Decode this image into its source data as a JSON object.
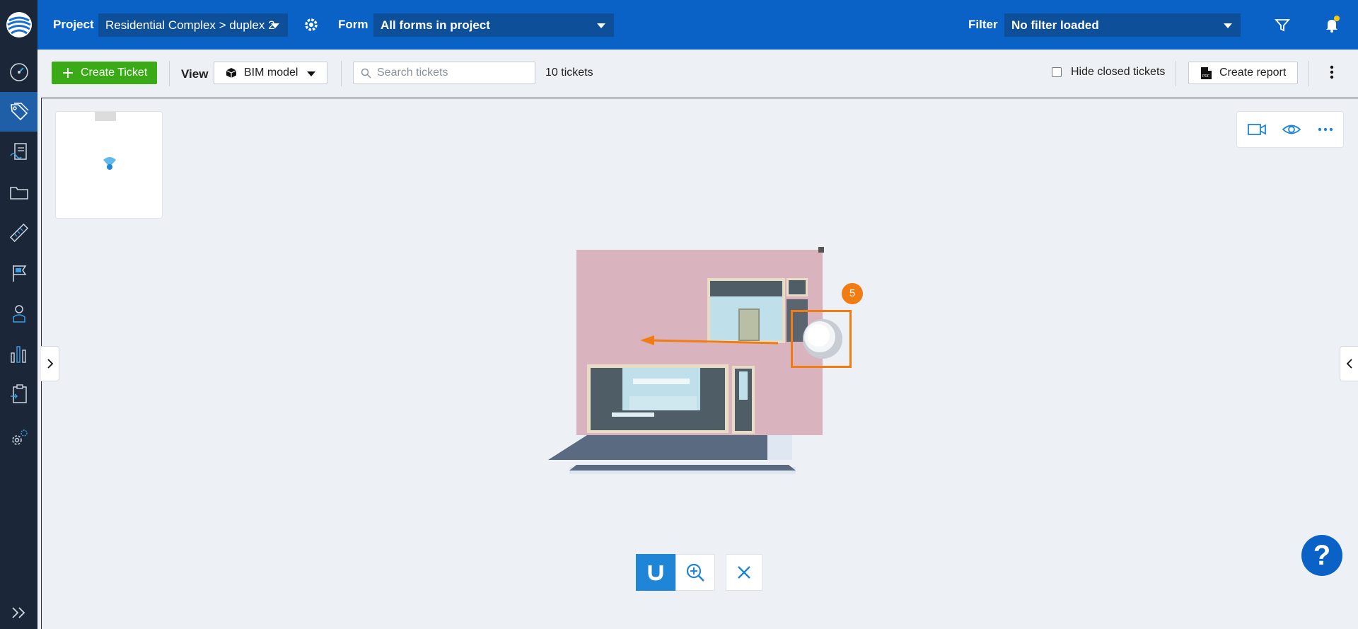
{
  "header": {
    "project_label": "Project",
    "project_value": "Residential Complex > duplex 2",
    "form_label": "Form",
    "form_value": "All forms in project",
    "filter_label": "Filter",
    "filter_value": "No filter loaded",
    "icons": [
      "gear-icon",
      "filter-icon",
      "bell-icon"
    ],
    "accent": "#0a62c6"
  },
  "sidebar": {
    "items": [
      {
        "icon": "dashboard-icon"
      },
      {
        "icon": "tag-icon",
        "active": true
      },
      {
        "icon": "document-sign-icon"
      },
      {
        "icon": "folder-icon"
      },
      {
        "icon": "ruler-icon"
      },
      {
        "icon": "flag-icon"
      },
      {
        "icon": "user-icon"
      },
      {
        "icon": "bar-chart-icon"
      },
      {
        "icon": "clipboard-icon"
      },
      {
        "icon": "settings-icon"
      }
    ],
    "expand_icon": "double-chevron-right-icon"
  },
  "toolbar": {
    "create_ticket_label": "Create Ticket",
    "view_label": "View",
    "view_value": "BIM model",
    "search_placeholder": "Search tickets",
    "tickets_count": "10 tickets",
    "hide_closed_label": "Hide closed tickets",
    "hide_closed_checked": false,
    "create_report_label": "Create report"
  },
  "viewer": {
    "pin_number": "5",
    "tools_top": [
      "video-camera-icon",
      "eye-icon",
      "more-horizontal-icon"
    ],
    "tools_bottom": [
      "magnet-icon",
      "zoom-in-icon",
      "close-icon"
    ],
    "help_label": "?"
  }
}
